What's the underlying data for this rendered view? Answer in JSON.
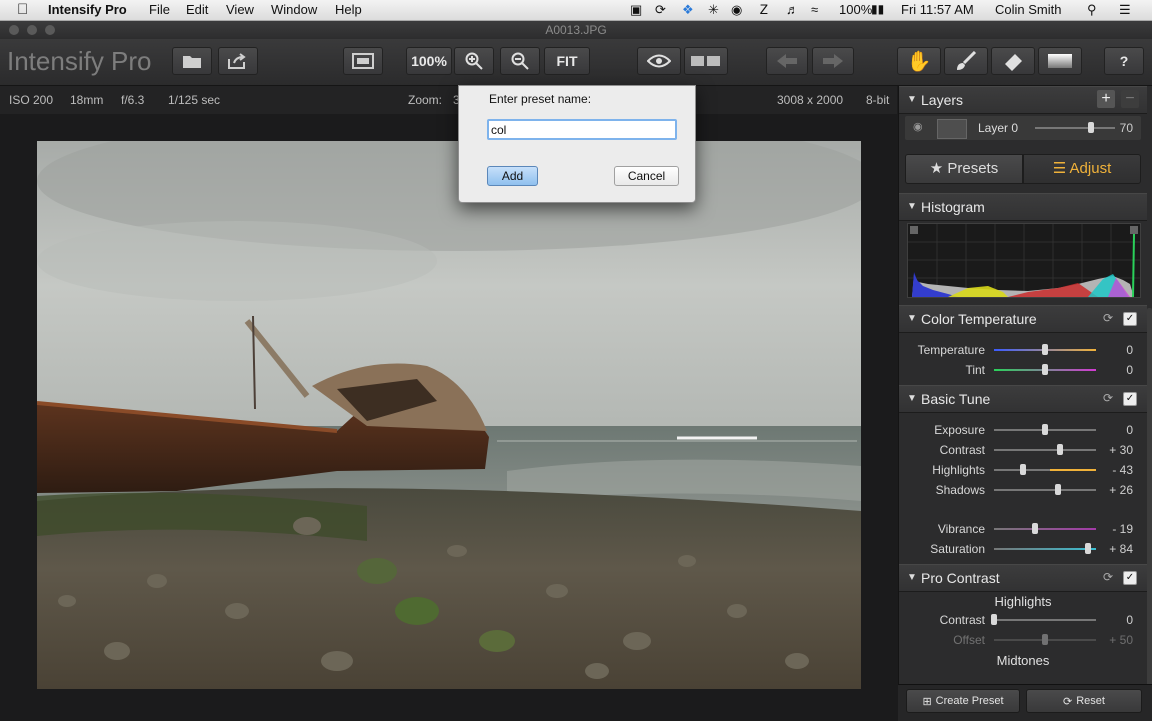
{
  "menubar": {
    "app": "Intensify Pro",
    "items": [
      "File",
      "Edit",
      "View",
      "Window",
      "Help"
    ],
    "battery": "100%",
    "clock": "Fri 11:57 AM",
    "user": "Colin Smith"
  },
  "window": {
    "title": "A0013.JPG"
  },
  "toolbar": {
    "logo": "Intensify Pro",
    "zoom_label": "100%",
    "fit_label": "FIT",
    "help_label": "?"
  },
  "info": {
    "iso": "ISO 200",
    "focal": "18mm",
    "aperture": "f/6.3",
    "shutter": "1/125 sec",
    "zoom_label": "Zoom:",
    "zoom_partial": "3",
    "dimensions": "3008 x 2000",
    "bitdepth": "8-bit"
  },
  "dialog": {
    "prompt": "Enter preset name:",
    "value": "col",
    "add_label": "Add",
    "cancel_label": "Cancel"
  },
  "panel": {
    "layers": {
      "title": "Layers",
      "layer_name": "Layer 0",
      "opacity": "70",
      "opacity_level": 0.7
    },
    "tabs": {
      "presets": "Presets",
      "adjust": "Adjust"
    },
    "histogram": {
      "title": "Histogram"
    },
    "color_temperature": {
      "title": "Color Temperature",
      "rows": [
        {
          "label": "Temperature",
          "value": "0",
          "level": 0.5
        },
        {
          "label": "Tint",
          "value": "0",
          "level": 0.5
        }
      ]
    },
    "basic_tune": {
      "title": "Basic Tune",
      "rows": [
        {
          "label": "Exposure",
          "value": "0",
          "level": 0.5
        },
        {
          "label": "Contrast",
          "value": "+ 30",
          "level": 0.65
        },
        {
          "label": "Highlights",
          "value": "- 43",
          "level": 0.285
        },
        {
          "label": "Shadows",
          "value": "+ 26",
          "level": 0.63
        },
        {
          "label": "Vibrance",
          "value": "- 19",
          "level": 0.405
        },
        {
          "label": "Saturation",
          "value": "+ 84",
          "level": 0.92
        }
      ]
    },
    "pro_contrast": {
      "title": "Pro Contrast",
      "highlights_label": "Highlights",
      "contrast_label": "Contrast",
      "contrast_value": "0",
      "offset_label": "Offset",
      "offset_value": "+ 50",
      "midtones_label": "Midtones"
    },
    "bottom": {
      "create_preset": "Create Preset",
      "reset": "Reset"
    }
  },
  "colors": {
    "accent": "#f0b23a",
    "dialog_button": "#8fc0ee"
  }
}
